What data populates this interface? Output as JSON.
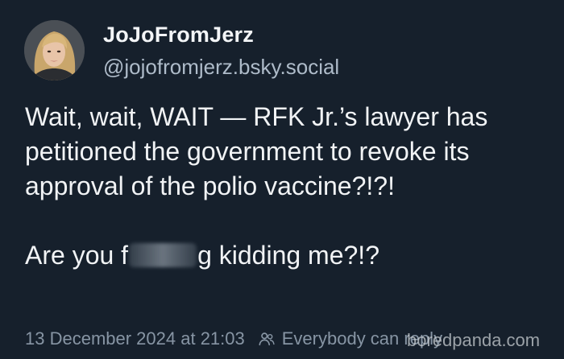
{
  "post": {
    "author": {
      "display_name": "JoJoFromJerz",
      "handle": "@jojofromjerz.bsky.social",
      "avatar_icon": "profile-photo"
    },
    "text": {
      "line1": "Wait, wait, WAIT — RFK Jr.’s lawyer has petitioned the government to revoke its approval of the polio vaccine?!?!",
      "line2_start": "Are you f",
      "line2_end": "g kidding me?!?"
    },
    "meta": {
      "timestamp": "13 December 2024 at 21:03",
      "reply_setting": "Everybody can reply",
      "reply_icon": "people-icon"
    }
  },
  "watermark": "boredpanda.com",
  "colors": {
    "background": "#16202c",
    "text": "#f1f3f5",
    "handle": "#aebbc9",
    "meta": "#8795a4"
  }
}
